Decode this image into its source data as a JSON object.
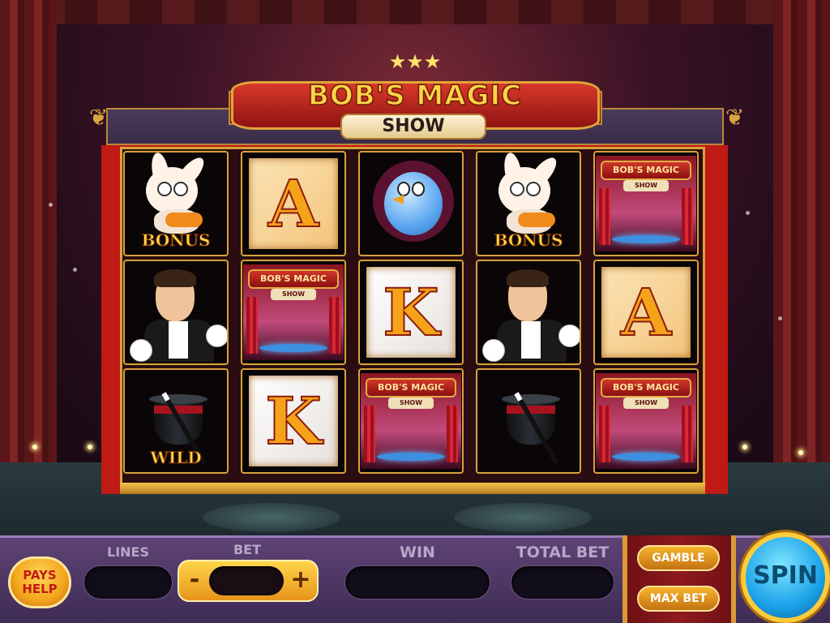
{
  "title": {
    "main": "BOB'S MAGIC",
    "sub": "SHOW"
  },
  "reels": {
    "labels": {
      "bonus": "BONUS",
      "wild": "WILD",
      "ace": "A",
      "king": "K",
      "theater_title": "BOB'S MAGIC",
      "theater_sub": "SHOW"
    }
  },
  "controls": {
    "pays_help": "PAYS HELP",
    "lines_label": "LINES",
    "lines_value": "",
    "bet_label": "BET",
    "bet_value": "",
    "bet_minus": "-",
    "bet_plus": "+",
    "win_label": "WIN",
    "win_value": "",
    "total_bet_label": "TOTAL BET",
    "total_bet_value": "",
    "gamble": "GAMBLE",
    "max_bet": "MAX BET",
    "spin": "SPIN"
  },
  "colors": {
    "accent": "#d8a23a",
    "frame_red": "#c01a14",
    "spin_blue": "#1ba2e8",
    "bar_purple": "#4e3766"
  }
}
